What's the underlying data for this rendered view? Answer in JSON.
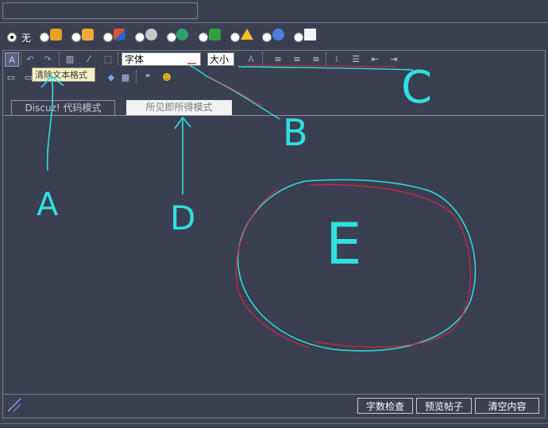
{
  "radio_row": {
    "none_label": "无",
    "icons": [
      "smiley-icon",
      "thumbs-up-icon",
      "cube-icon",
      "gear-icon",
      "globe-icon",
      "monitor-icon",
      "warning-icon",
      "info-icon",
      "document-icon"
    ]
  },
  "toolbar": {
    "font_value": "字体",
    "size_value": "大小",
    "tooltip": "清除文本格式"
  },
  "tabs": {
    "discuz_label": "Discuz! 代码模式",
    "wysiwyg_label": "所见即所得模式"
  },
  "buttons": {
    "word_count": "字数检查",
    "preview": "预览帖子",
    "clear": "清空内容"
  },
  "annotations": {
    "a": "A",
    "b": "B",
    "c": "C",
    "d": "D",
    "e": "E"
  },
  "colors": {
    "background": "#3b3f52",
    "annotation_cyan": "#2fe0e0",
    "annotation_red": "#d2283c"
  }
}
